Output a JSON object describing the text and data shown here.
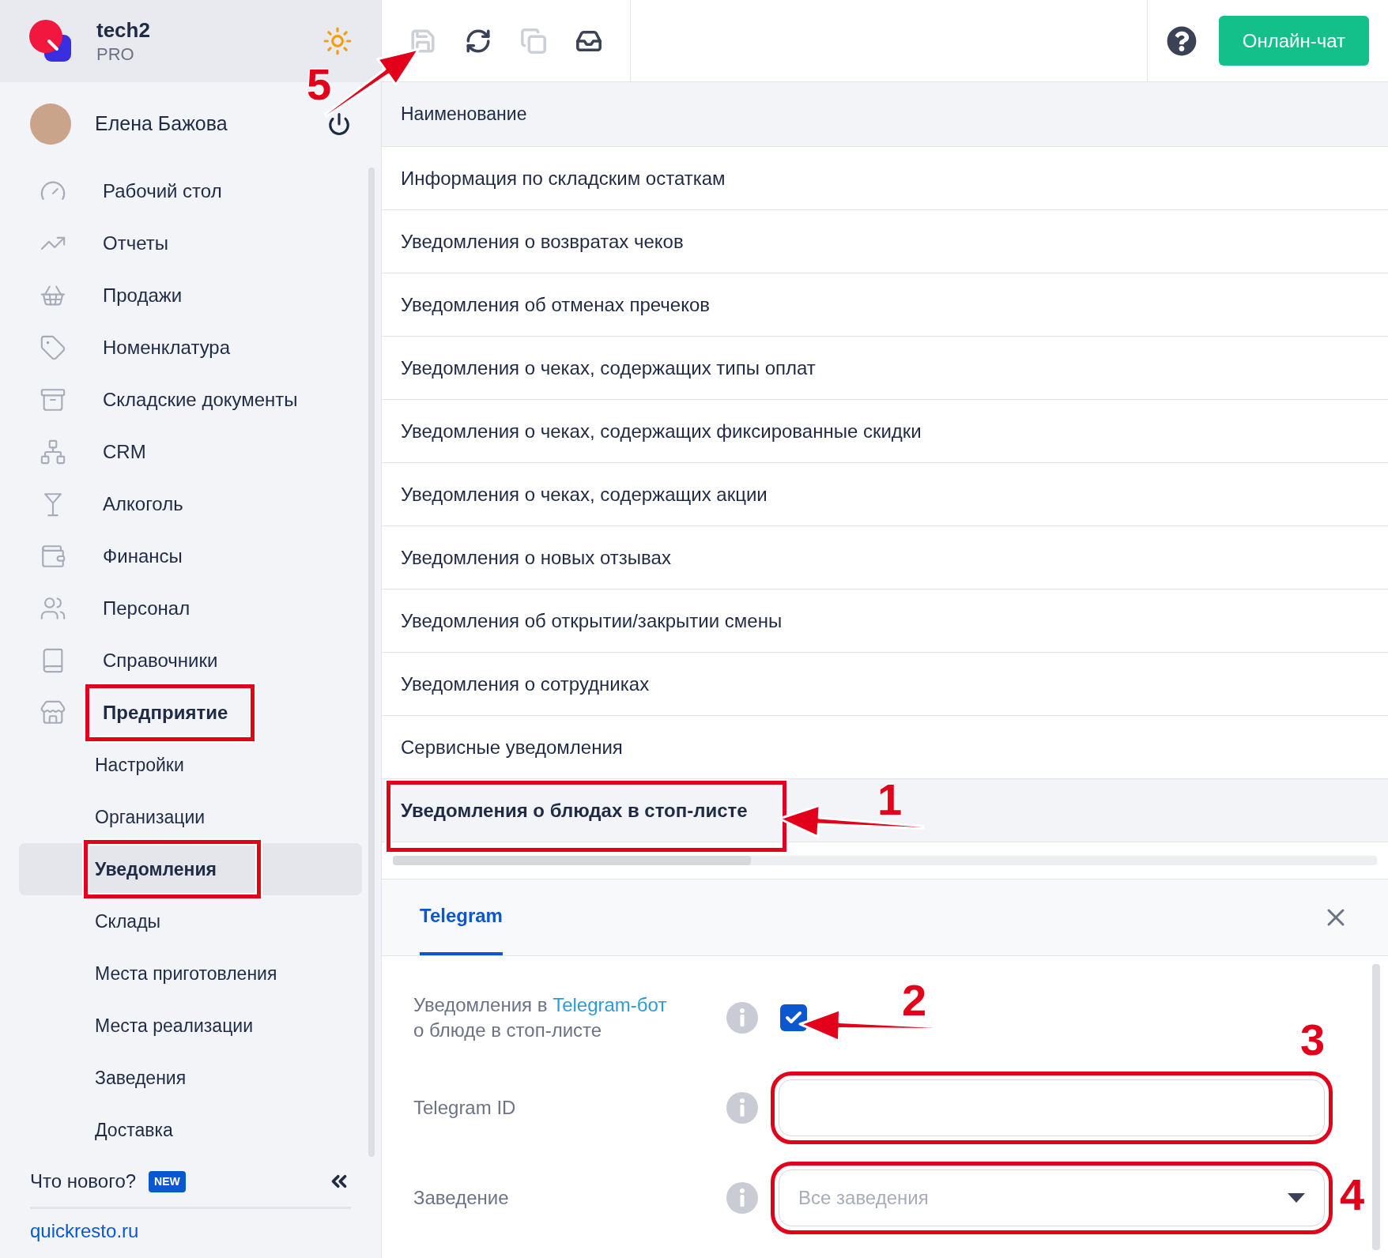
{
  "app": {
    "name": "tech2",
    "plan": "PRO"
  },
  "user": {
    "name": "Елена Бажова"
  },
  "nav": [
    {
      "label": "Рабочий стол",
      "selected": false,
      "expanded": false
    },
    {
      "label": "Отчеты",
      "selected": false,
      "expanded": false
    },
    {
      "label": "Продажи",
      "selected": false,
      "expanded": false
    },
    {
      "label": "Номенклатура",
      "selected": false,
      "expanded": false
    },
    {
      "label": "Складские документы",
      "selected": false,
      "expanded": false
    },
    {
      "label": "CRM",
      "selected": false,
      "expanded": false
    },
    {
      "label": "Алкоголь",
      "selected": false,
      "expanded": false
    },
    {
      "label": "Финансы",
      "selected": false,
      "expanded": false
    },
    {
      "label": "Персонал",
      "selected": false,
      "expanded": false
    },
    {
      "label": "Справочники",
      "selected": false,
      "expanded": false
    },
    {
      "label": "Предприятие",
      "selected": false,
      "expanded": true,
      "framed": true,
      "children": [
        {
          "label": "Настройки",
          "selected": false
        },
        {
          "label": "Организации",
          "selected": false
        },
        {
          "label": "Уведомления",
          "selected": true,
          "framed": true
        },
        {
          "label": "Склады",
          "selected": false
        },
        {
          "label": "Места приготовления",
          "selected": false
        },
        {
          "label": "Места реализации",
          "selected": false
        },
        {
          "label": "Заведения",
          "selected": false
        },
        {
          "label": "Доставка",
          "selected": false
        }
      ]
    }
  ],
  "whats_new": {
    "label": "Что нового?",
    "badge": "NEW"
  },
  "site_link": "quickresto.ru",
  "toolbar": [
    {
      "disabled": true
    },
    {
      "disabled": false
    },
    {
      "disabled": true
    },
    {
      "disabled": false
    }
  ],
  "chat_button": "Онлайн-чат",
  "table": {
    "column": "Наименование",
    "rows": [
      {
        "name": "Информация по складским остаткам",
        "selected": false
      },
      {
        "name": "Уведомления о возвратах чеков",
        "selected": false
      },
      {
        "name": "Уведомления об отменах пречеков",
        "selected": false
      },
      {
        "name": "Уведомления о чеках, содержащих типы оплат",
        "selected": false
      },
      {
        "name": "Уведомления о чеках, содержащих фиксированные скидки",
        "selected": false
      },
      {
        "name": "Уведомления о чеках, содержащих акции",
        "selected": false
      },
      {
        "name": "Уведомления о новых отзывах",
        "selected": false
      },
      {
        "name": "Уведомления об открытии/закрытии смены",
        "selected": false
      },
      {
        "name": "Уведомления о сотрудниках",
        "selected": false
      },
      {
        "name": "Сервисные уведомления",
        "selected": false
      },
      {
        "name": "Уведомления о блюдах в стоп-листе",
        "selected": true,
        "framed": true
      }
    ]
  },
  "panel": {
    "tabs": [
      {
        "label": "Telegram",
        "selected": true
      }
    ],
    "fields": [
      {
        "kind": "checkbox",
        "label": "Уведомления в",
        "link": "Telegram-бот",
        "label_end": "о блюде в стоп-листе",
        "checked": true
      },
      {
        "kind": "text",
        "label": "Telegram ID",
        "framed": true
      },
      {
        "kind": "select",
        "label": "Заведение",
        "placeholder": "Все заведения",
        "framed": true
      }
    ]
  },
  "callouts": [
    {
      "number": "1"
    },
    {
      "number": "2"
    },
    {
      "number": "3"
    },
    {
      "number": "4"
    },
    {
      "number": "5"
    }
  ]
}
